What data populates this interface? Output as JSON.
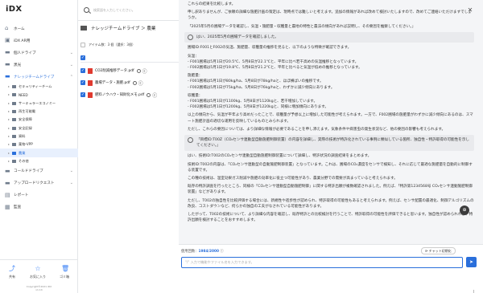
{
  "app": {
    "logo": "iDX"
  },
  "sidebar": {
    "items": [
      {
        "label": "ホーム",
        "icon": "home-icon"
      },
      {
        "label": "iDX AR用",
        "icon": "box-icon"
      },
      {
        "label": "個人ドライブ",
        "icon": "folder-icon"
      },
      {
        "label": "黒光",
        "icon": "folder-icon"
      },
      {
        "label": "ナレッジチームドライブ",
        "icon": "folder-icon"
      }
    ],
    "subfolders": [
      "セキュリティーチーム",
      "NEED",
      "サーキュラーエコノミー",
      "再生可能電",
      "安全保障",
      "安全記録",
      "資料",
      "薬物-VPP",
      "農業",
      "その他"
    ],
    "bottom_items": [
      {
        "label": "コールドドライブ",
        "icon": "folder-icon"
      },
      {
        "label": "アップロードリクエスト",
        "icon": "folder-icon"
      },
      {
        "label": "レポート",
        "icon": "report-icon"
      },
      {
        "label": "監査",
        "icon": "audit-icon"
      }
    ],
    "footer": {
      "share": "共有",
      "favorite": "お気に入り",
      "trash": "ゴミ箱",
      "copyright": "Copyright©2021 iDX",
      "version": "v1.14"
    }
  },
  "search": {
    "placeholder": "検索語を入力してください。"
  },
  "content": {
    "breadcrumb": "ナレッジチームドライブ ＞ 農業",
    "count_label": "アイテム数：3 個（選択：3個）",
    "files": [
      {
        "name": "CO2削減推移データ.pdf"
      },
      {
        "name": "農場データ・施肥.pdf"
      },
      {
        "name": "肥料ノウハウ・知財化メモ.pdf"
      }
    ]
  },
  "chat": {
    "messages": [
      {
        "role": "ai",
        "paras": [
          "これらの結果を比較します。",
          "申し訳ありませんが、ご依頼の詳細な施肥計画の策定は、現時点では難しいと考えます。追加の情報があれば改めて検討いたしますので、改めてご連絡いただけますでしょうか。",
          "「2025年5月の圃場データを確認し、気温・施肥量・収穫量と農地の特性と農法の傾向があれば説明し、その要因を推察してください。」"
        ]
      },
      {
        "role": "user",
        "text": "はい、2025年5月の圃場データを確認しました。"
      },
      {
        "role": "ai",
        "paras": [
          "圃場ID:F001とF002の気温、施肥量、収穫量の推移を見ると、以下のような特徴が確認できます。",
          "気温：\n- F001圃場は5月1日が20.5℃、5月8日が22.1℃と、平年に比べ若干高めの気温推移となっています。\n- F002圃場は5月1日が19.8℃、5月8日が21.2℃と、平年と比べると気温が低めの推移となっています。",
          "施肥量：\n- F001圃場は5月1日が80kg/ha、5月8日が78kg/haと、ほぼ横ばいの推移です。\n- F002圃場は5月1日が75kg/ha、5月8日が76kg/haと、わずかに減少傾向にあります。",
          "収穫量：\n- F001圃場は5月1日が1100kg、5月8日が1120kgと、若干増加しています。\n- F002圃場は5月1日が1200kg、5月8日が1220kgと、同様に増加傾向にあります。",
          "以上の傾向から、気温が平年より高めだったことで、収穫量が予想以上に増加した可能性が考えられます。一方で、F002圃場の施肥量がわずかに減少傾向にあるのは、スマート施肥計画の適切な運用を反映しているものとみられます。",
          "ただし、これらの要因については、より詳細な情報が必要であることを申し添えます。気象条件や病害虫の発生状況など、他の要因の影響も考えられます。"
        ]
      },
      {
        "role": "user",
        "text": "「目標ID:T00Z（CO₂センサ連動型自動施肥制御装置）の内容を詳細し、実際の技術が特許化されている事例に類似している箇所、独自性・特許取得の可能性を示してください。」"
      },
      {
        "role": "ai",
        "paras": [
          "はい、技術ID:T002のCO₂センサ連動型自動施肥制御装置について詳細し、特許状況の調査結果をまとめます。",
          "技術ID:T002の内容は、「CO₂センサ連動型の自動施肥制御装置」となっています。これは、圃場のCO₂濃度をセンサで検知し、それに応じて最適な施肥量を自動的に制御する装置です。",
          "この種の技術は、温室効果ガス削減や施肥の効率化に役立つ可能性があり、農業分野での需要が高まっていると考えられます。",
          "既存の特許調査を行ったところ、同様の「CO₂センサ連動型自動施肥制御」に関する特許出願が複数確認されました。例えば、「特許第1234568号 CO₂センサ連動施肥制御装置」などがあります。",
          "ただし、T002の独自性を比較評価する場合には、新規性や進歩性が認められ、特許取得の可能性もあると考えられます。例えば、センサ配置の最適化、制御アルゴリズムの改良、コストダウンなど、何らかの独自の工夫がなされている可能性があります。",
          "したがって、T002の技術について、より詳細な内容を確認し、既存特許との比較検討を行うことで、特許取得の可能性を評価できると思います。独自性が認められれば、特許出願を検討することをおすすめします。"
        ]
      }
    ]
  },
  "composer": {
    "counter_label": "使用回数：",
    "counter_value": "1984/2000",
    "counter_help": "ⓘ",
    "reset_label": "チャット初期化",
    "placeholder": "\"/\" 入力で機能やファイル名を入力できます。",
    "send_icon": "send-icon"
  },
  "colors": {
    "accent": "#2a6fdb",
    "sidebar_active_bg": "#e8f0fd",
    "pdf": "#e03a2f"
  }
}
